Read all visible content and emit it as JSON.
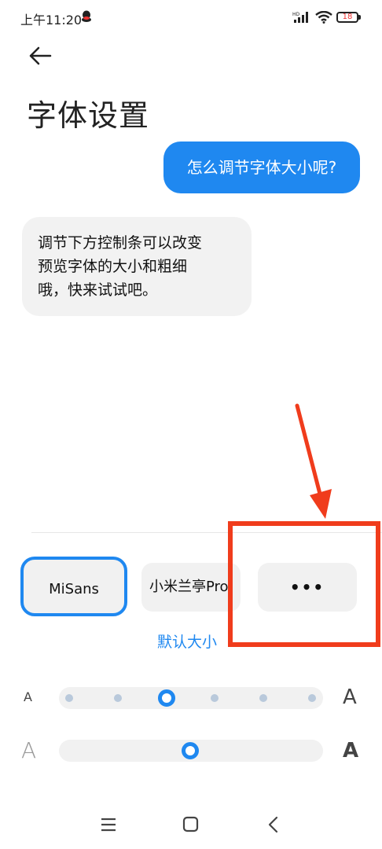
{
  "status_bar": {
    "time": "上午11:20",
    "battery": "18"
  },
  "page": {
    "title": "字体设置"
  },
  "chat": {
    "question": "怎么调节字体大小呢?",
    "answer_lines": [
      "调节下方控制条可以改变",
      "预览字体的大小和粗细",
      "哦，快来试试吧。"
    ]
  },
  "font_options": {
    "misans": "MiSans",
    "xiaomi": "小米兰亭Pro",
    "more": "•••"
  },
  "default_size_label": "默认大小",
  "size_slider": {
    "small_label": "A",
    "large_label": "A",
    "steps": 6,
    "selected_index": 2
  },
  "weight_slider": {
    "thin_label": "A",
    "bold_label": "A",
    "value": 0.5
  },
  "colors": {
    "accent": "#1f88f0",
    "highlight": "#f03c1c"
  },
  "icons": [
    "back-arrow-icon",
    "menu-icon",
    "home-icon",
    "back-nav-icon"
  ]
}
